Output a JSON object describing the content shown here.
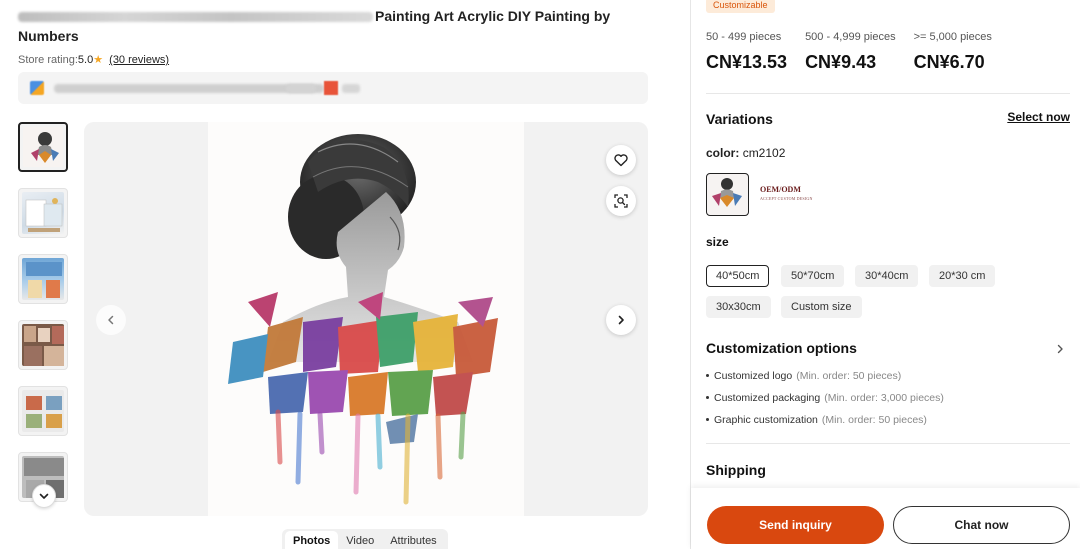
{
  "product": {
    "title_visible": "Painting Art Acrylic DIY Painting by Numbers",
    "store_rating_label": "Store rating:",
    "store_rating_value": "5.0",
    "reviews_link": "(30 reviews)"
  },
  "gallery": {
    "tabs": [
      {
        "label": "Photos",
        "active": true
      },
      {
        "label": "Video",
        "active": false
      },
      {
        "label": "Attributes",
        "active": false
      }
    ],
    "thumbnail_count": 6,
    "active_thumbnail": 1
  },
  "pricing": {
    "badge": "Customizable",
    "tiers": [
      {
        "quantity": "50 - 499 pieces",
        "price": "CN¥13.53"
      },
      {
        "quantity": "500 - 4,999 pieces",
        "price": "CN¥9.43"
      },
      {
        "quantity": ">= 5,000 pieces",
        "price": "CN¥6.70"
      }
    ]
  },
  "variations": {
    "title": "Variations",
    "select_now": "Select now",
    "color_label": "color:",
    "color_value": "cm2102",
    "oem_text": "OEM/ODM",
    "oem_subtext": "ACCEPT CUSTOM DESIGN",
    "size_label": "size",
    "sizes": [
      {
        "label": "40*50cm",
        "selected": true
      },
      {
        "label": "50*70cm",
        "selected": false
      },
      {
        "label": "30*40cm",
        "selected": false
      },
      {
        "label": "20*30 cm",
        "selected": false
      },
      {
        "label": "30x30cm",
        "selected": false
      },
      {
        "label": "Custom size",
        "selected": false
      }
    ]
  },
  "customization": {
    "title": "Customization options",
    "items": [
      {
        "label": "Customized logo",
        "min": "(Min. order: 50 pieces)"
      },
      {
        "label": "Customized packaging",
        "min": "(Min. order: 3,000 pieces)"
      },
      {
        "label": "Graphic customization",
        "min": "(Min. order: 50 pieces)"
      }
    ]
  },
  "shipping": {
    "title": "Shipping"
  },
  "actions": {
    "send_inquiry": "Send inquiry",
    "chat_now": "Chat now"
  },
  "colors": {
    "accent": "#d9480f",
    "badge_bg": "#fdebd9",
    "badge_text": "#d9560b",
    "star": "#f5a623"
  },
  "icons": {
    "favorite": "heart-icon",
    "image_search": "image-search-icon",
    "prev": "chevron-left-icon",
    "next": "chevron-right-icon",
    "thumbs_down": "chevron-down-icon",
    "rating_star": "star-icon"
  }
}
